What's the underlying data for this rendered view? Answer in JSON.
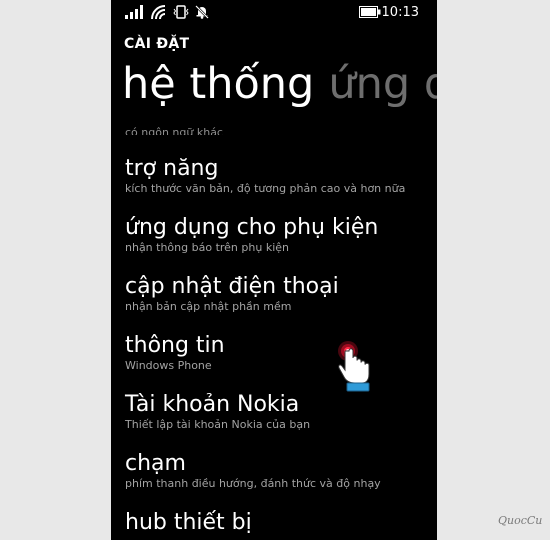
{
  "status": {
    "time": "10:13",
    "icons": [
      "signal-icon",
      "wifi-icon",
      "vibrate-icon",
      "bell-off-icon",
      "battery-icon"
    ]
  },
  "header": {
    "app_title": "CÀI ĐẶT",
    "pivot_active": "hệ thống",
    "pivot_next": "ứng d"
  },
  "settings": {
    "partial_sub": "có ngôn ngữ khác",
    "items": [
      {
        "title": "trợ năng",
        "sub": "kích thước văn bản, độ tương phản cao và hơn nữa"
      },
      {
        "title": "ứng dụng cho phụ kiện",
        "sub": "nhận thông báo trên phụ kiện"
      },
      {
        "title": "cập nhật điện thoại",
        "sub": "nhận bản cập nhật phần mềm"
      },
      {
        "title": "thông tin",
        "sub": "Windows Phone"
      },
      {
        "title": "Tài khoản Nokia",
        "sub": "Thiết lập tài khoản Nokia của bạn"
      },
      {
        "title": "chạm",
        "sub": "phím thanh điều hướng, đánh thức và độ nhạy"
      },
      {
        "title": "hub thiết bị",
        "sub": ""
      }
    ]
  },
  "annotation": {
    "tap_marker": "tap-hand-icon",
    "watermark": "QuocCu"
  },
  "colors": {
    "background": "#000000",
    "text_primary": "#ffffff",
    "text_secondary": "#a3a3a3",
    "pivot_inactive": "#6e6e6e",
    "tap_red": "#d0102a",
    "cuff_blue": "#2f9bd8"
  }
}
